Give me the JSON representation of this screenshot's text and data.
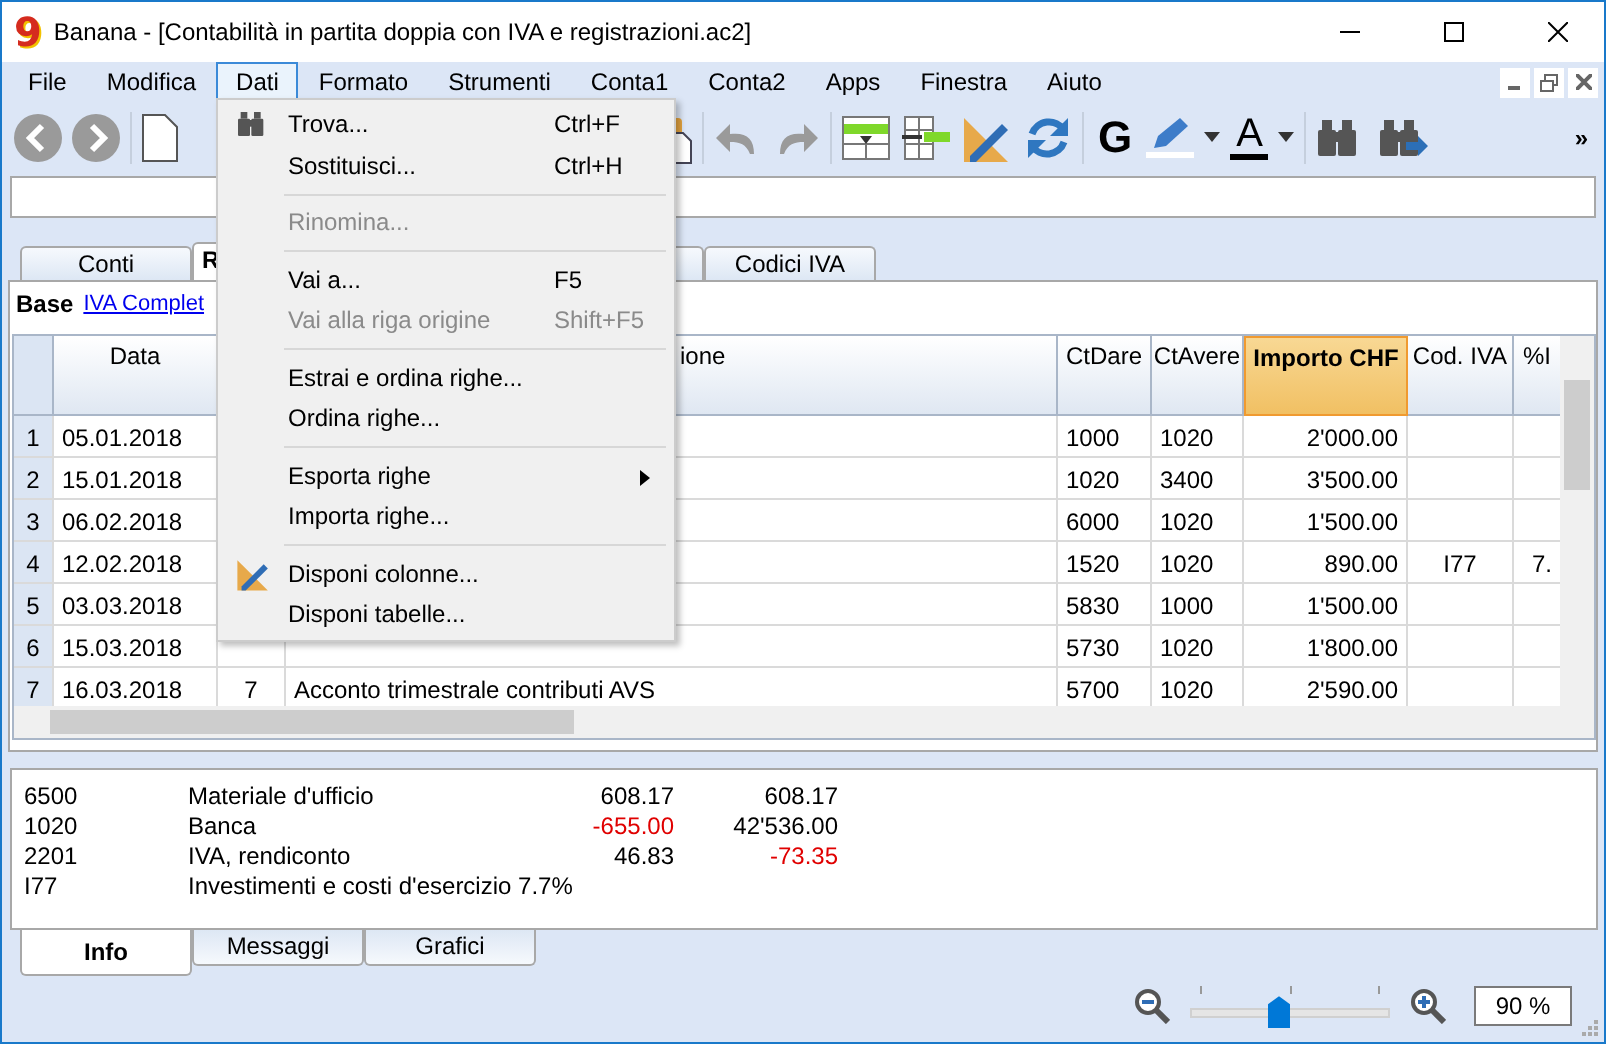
{
  "window": {
    "logo": "9",
    "title": "Banana - [Contabilità in partita doppia con IVA e registrazioni.ac2]"
  },
  "menu_bar": [
    {
      "label": "File",
      "selected": false
    },
    {
      "label": "Modifica",
      "selected": false
    },
    {
      "label": "Dati",
      "selected": true
    },
    {
      "label": "Formato",
      "selected": false
    },
    {
      "label": "Strumenti",
      "selected": false
    },
    {
      "label": "Conta1",
      "selected": false
    },
    {
      "label": "Conta2",
      "selected": false
    },
    {
      "label": "Apps",
      "selected": false
    },
    {
      "label": "Finestra",
      "selected": false
    },
    {
      "label": "Aiuto",
      "selected": false
    }
  ],
  "toolbar": {
    "bold_label": "G",
    "text_color_label": "A",
    "overflow": "»"
  },
  "tabs": [
    {
      "label": "Conti",
      "selected": false
    },
    {
      "label": "R",
      "selected": true
    },
    {
      "selected": false
    },
    {
      "label": "Codici IVA",
      "selected": false
    }
  ],
  "view_bar": {
    "label": "Base",
    "link": "IVA Complet"
  },
  "table": {
    "columns": [
      {
        "selected": false
      },
      {
        "label": "Data",
        "selected": false
      },
      {
        "label": "ione",
        "selected": false
      },
      {
        "label": "CtDare",
        "selected": false
      },
      {
        "label": "CtAvere",
        "selected": false
      },
      {
        "label": "Importo CHF",
        "selected": true
      },
      {
        "label": "Cod. IVA",
        "selected": false
      },
      {
        "label": "%I",
        "selected": false
      }
    ],
    "rows": [
      {
        "number": "1",
        "date": "05.01.2018",
        "debit": "1000",
        "credit": "1020",
        "amount": "2'000.00"
      },
      {
        "number": "2",
        "date": "15.01.2018",
        "debit": "1020",
        "credit": "3400",
        "amount": "3'500.00"
      },
      {
        "number": "3",
        "date": "06.02.2018",
        "debit": "6000",
        "credit": "1020",
        "amount": "1'500.00"
      },
      {
        "number": "4",
        "date": "12.02.2018",
        "debit": "1520",
        "credit": "1020",
        "amount": "890.00",
        "vat_code": "I77",
        "vat_pct": "7."
      },
      {
        "number": "5",
        "date": "03.03.2018",
        "debit": "5830",
        "credit": "1000",
        "amount": "1'500.00"
      },
      {
        "number": "6",
        "date": "15.03.2018",
        "debit": "5730",
        "credit": "1020",
        "amount": "1'800.00"
      },
      {
        "number": "7",
        "date": "16.03.2018",
        "doc": "7",
        "description": "Acconto trimestrale contributi AVS",
        "debit": "5700",
        "credit": "1020",
        "amount": "2'590.00"
      }
    ]
  },
  "info_panel": {
    "lines": [
      {
        "code": "6500",
        "name": "Materiale d'ufficio",
        "values": [
          {
            "text": "608.17",
            "negative": false
          },
          {
            "text": "608.17",
            "negative": false
          }
        ]
      },
      {
        "code": "1020",
        "name": "Banca",
        "values": [
          {
            "text": "-655.00",
            "negative": true
          },
          {
            "text": "42'536.00",
            "negative": false
          }
        ]
      },
      {
        "code": "2201",
        "name": "IVA, rendiconto",
        "values": [
          {
            "text": "46.83",
            "negative": false
          },
          {
            "text": "-73.35",
            "negative": true
          }
        ]
      },
      {
        "code": "I77",
        "name": "Investimenti e costi d'esercizio 7.7%"
      }
    ]
  },
  "bottom_tabs": [
    {
      "label": "Info",
      "selected": true
    },
    {
      "label": "Messaggi",
      "selected": false
    },
    {
      "label": "Grafici",
      "selected": false
    }
  ],
  "zoom": {
    "level": 0.44,
    "value": "90 %"
  },
  "dropdown": {
    "items": [
      {
        "kind": "item",
        "label": "Trova...",
        "shortcut": "Ctrl+F",
        "disabled": false
      },
      {
        "kind": "item",
        "label": "Sostituisci...",
        "shortcut": "Ctrl+H",
        "disabled": false
      },
      {
        "kind": "separator"
      },
      {
        "kind": "item",
        "label": "Rinomina...",
        "disabled": true
      },
      {
        "kind": "separator"
      },
      {
        "kind": "item",
        "label": "Vai a...",
        "shortcut": "F5",
        "disabled": false
      },
      {
        "kind": "item",
        "label": "Vai alla riga origine",
        "shortcut": "Shift+F5",
        "disabled": true
      },
      {
        "kind": "separator"
      },
      {
        "kind": "item",
        "label": "Estrai e ordina righe...",
        "disabled": false
      },
      {
        "kind": "item",
        "label": "Ordina righe...",
        "disabled": false
      },
      {
        "kind": "separator"
      },
      {
        "kind": "submenu",
        "label": "Esporta righe",
        "disabled": false
      },
      {
        "kind": "item",
        "label": "Importa righe...",
        "disabled": false
      },
      {
        "kind": "separator"
      },
      {
        "kind": "item",
        "label": "Disponi colonne...",
        "disabled": false
      },
      {
        "kind": "item",
        "label": "Disponi tabelle...",
        "disabled": false
      }
    ]
  }
}
